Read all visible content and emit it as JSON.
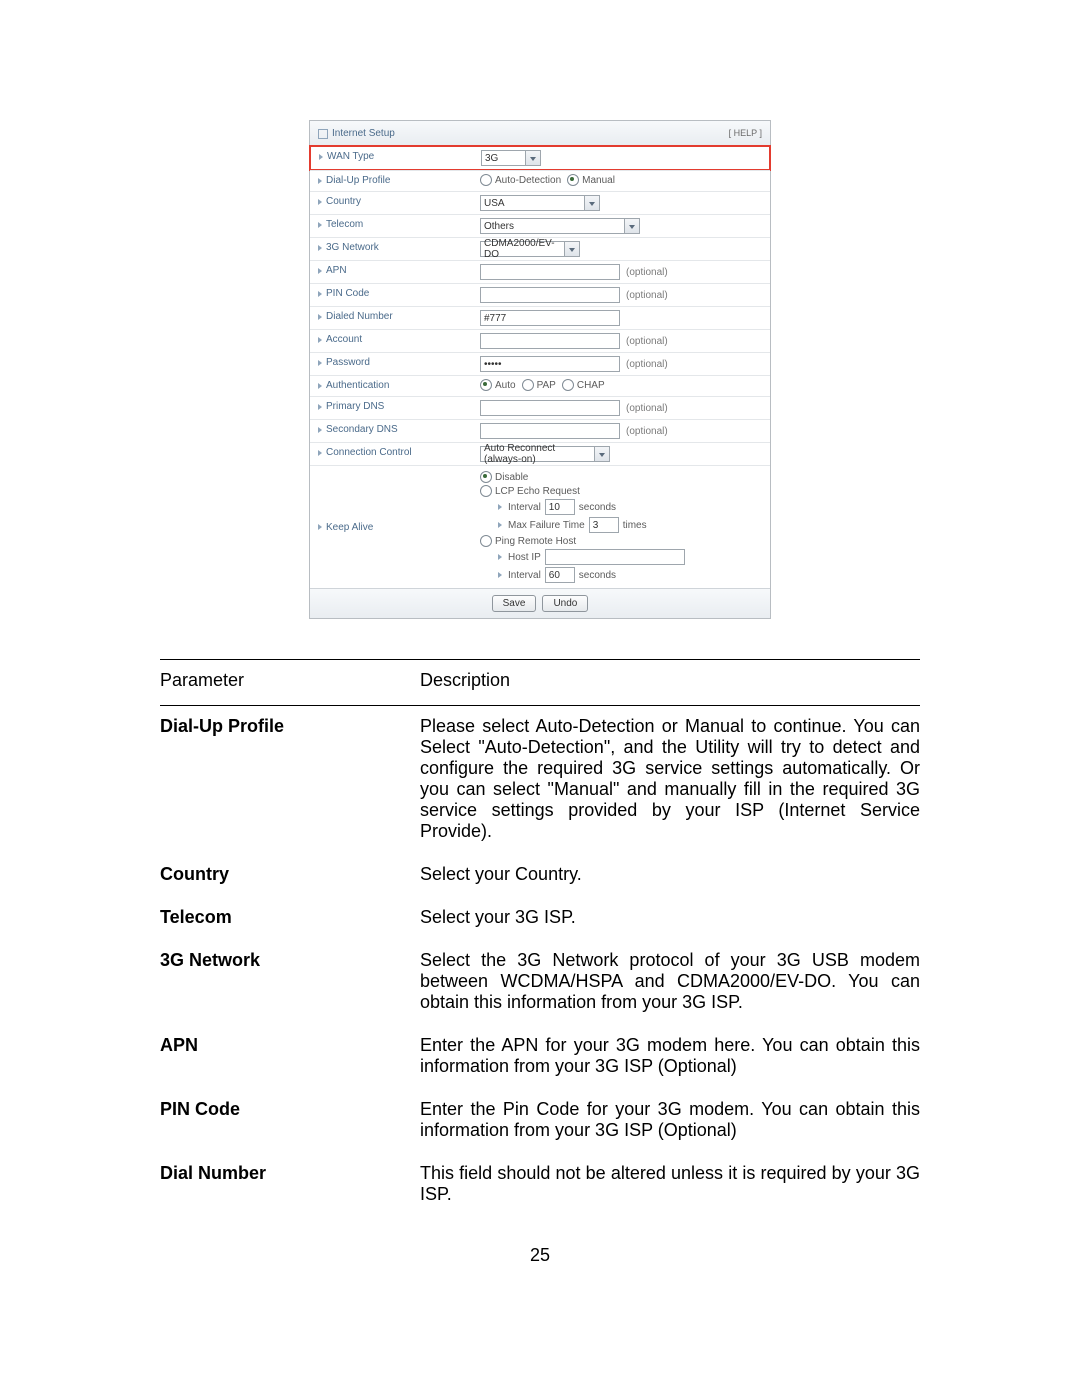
{
  "panel": {
    "title": "Internet Setup",
    "help": "[ HELP ]",
    "rows": {
      "wan_type": {
        "label": "WAN Type",
        "value": "3G"
      },
      "dialup": {
        "label": "Dial-Up Profile",
        "opt_auto": "Auto-Detection",
        "opt_manual": "Manual"
      },
      "country": {
        "label": "Country",
        "value": "USA"
      },
      "telecom": {
        "label": "Telecom",
        "value": "Others"
      },
      "network3g": {
        "label": "3G Network",
        "value": "CDMA2000/EV-DO"
      },
      "apn": {
        "label": "APN",
        "optional": "(optional)"
      },
      "pin": {
        "label": "PIN Code",
        "optional": "(optional)"
      },
      "dialed": {
        "label": "Dialed Number",
        "value": "#777"
      },
      "account": {
        "label": "Account",
        "optional": "(optional)"
      },
      "password": {
        "label": "Password",
        "value": "•••••",
        "optional": "(optional)"
      },
      "auth": {
        "label": "Authentication",
        "opt_auto": "Auto",
        "opt_pap": "PAP",
        "opt_chap": "CHAP"
      },
      "pdns": {
        "label": "Primary DNS",
        "optional": "(optional)"
      },
      "sdns": {
        "label": "Secondary DNS",
        "optional": "(optional)"
      },
      "conn": {
        "label": "Connection Control",
        "value": "Auto Reconnect (always-on)"
      },
      "keepalive": {
        "label": "Keep Alive",
        "opt_disable": "Disable",
        "opt_lcp": "LCP Echo Request",
        "sub_interval": "Interval",
        "sub_interval_val": "10",
        "sub_interval_unit": "seconds",
        "sub_maxfail": "Max Failure Time",
        "sub_maxfail_val": "3",
        "sub_maxfail_unit": "times",
        "opt_ping": "Ping Remote Host",
        "sub_hostip": "Host IP",
        "sub_interval2": "Interval",
        "sub_interval2_val": "60",
        "sub_interval2_unit": "seconds"
      }
    },
    "buttons": {
      "save": "Save",
      "undo": "Undo"
    }
  },
  "table": {
    "head_param": "Parameter",
    "head_desc": "Description",
    "rows": [
      {
        "param": "Dial-Up Profile",
        "desc": "Please select Auto-Detection or Manual to continue. You can Select \"Auto-Detection\", and the Utility will try to detect and configure the required 3G service settings automatically. Or you can select \"Manual\" and manually fill in the required 3G service settings provided by your ISP (Internet Service Provide)."
      },
      {
        "param": "Country",
        "desc": "Select your Country."
      },
      {
        "param": "Telecom",
        "desc": "Select your 3G ISP."
      },
      {
        "param": "3G Network",
        "desc": "Select the 3G Network protocol of your 3G USB modem between WCDMA/HSPA and CDMA2000/EV-DO. You can obtain this information from your 3G ISP."
      },
      {
        "param": "APN",
        "desc": "Enter the APN for your 3G modem here. You can obtain this information from your 3G ISP (Optional)"
      },
      {
        "param": "PIN Code",
        "desc": "Enter the Pin Code for your 3G modem. You can obtain this information from your 3G ISP (Optional)"
      },
      {
        "param": "Dial Number",
        "desc": "This field should not be altered unless it is required by your 3G ISP."
      }
    ]
  },
  "page_number": "25"
}
